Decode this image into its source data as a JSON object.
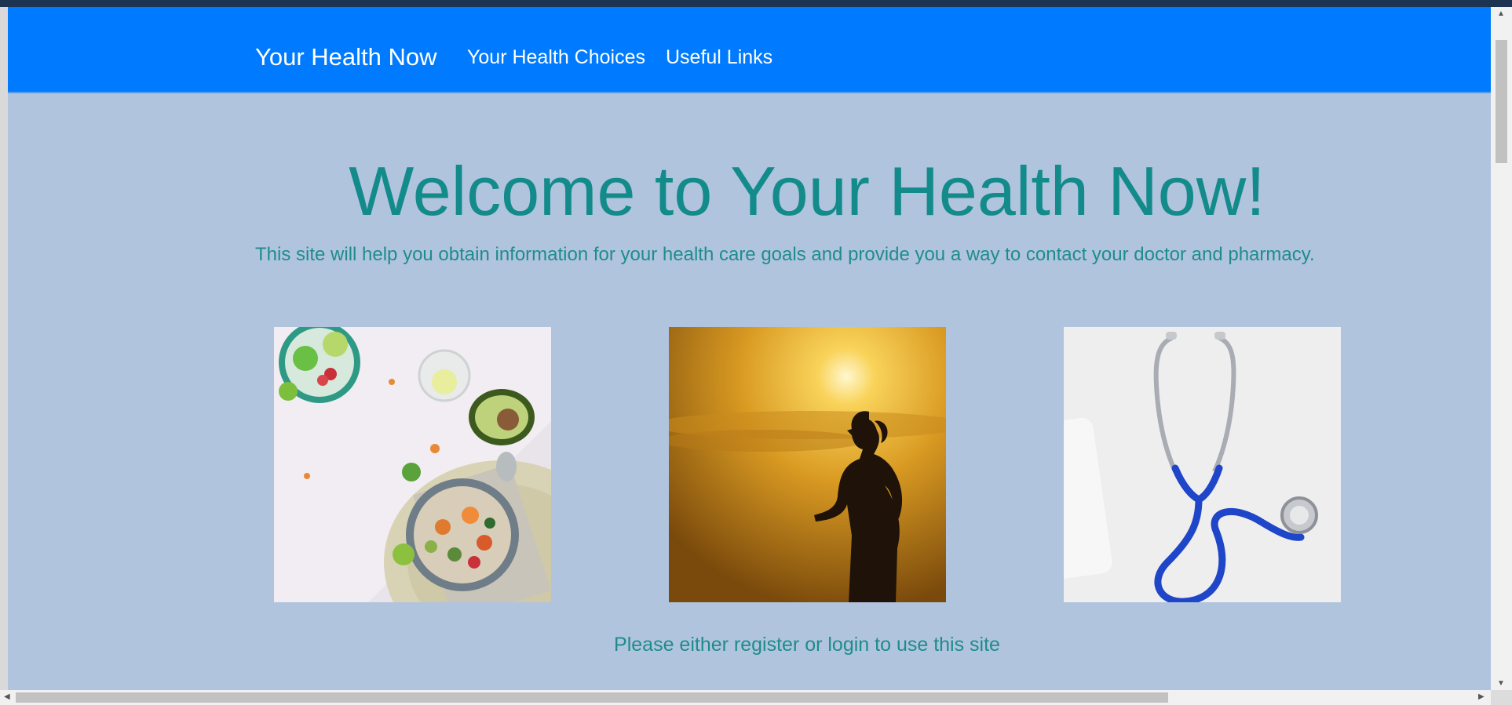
{
  "navbar": {
    "brand": "Your Health Now",
    "links": [
      "Your Health Choices",
      "Useful Links"
    ],
    "background": "#007bff"
  },
  "hero": {
    "title": "Welcome to Your Health Now!",
    "subtitle": "This site will help you obtain information for your health care goals and provide you a way to contact your doctor and pharmacy.",
    "text_color": "#138b8b"
  },
  "images": [
    {
      "subject": "healthy salad bowl with avocado and limes"
    },
    {
      "subject": "silhouette of woman running at sunset"
    },
    {
      "subject": "blue stethoscope on white surface"
    }
  ],
  "footer_notice": "Please either register or login to use this site",
  "page_background": "#b0c4de",
  "scrollbars": {
    "up_icon": "▲",
    "down_icon": "▼",
    "left_icon": "◀",
    "right_icon": "▶"
  }
}
